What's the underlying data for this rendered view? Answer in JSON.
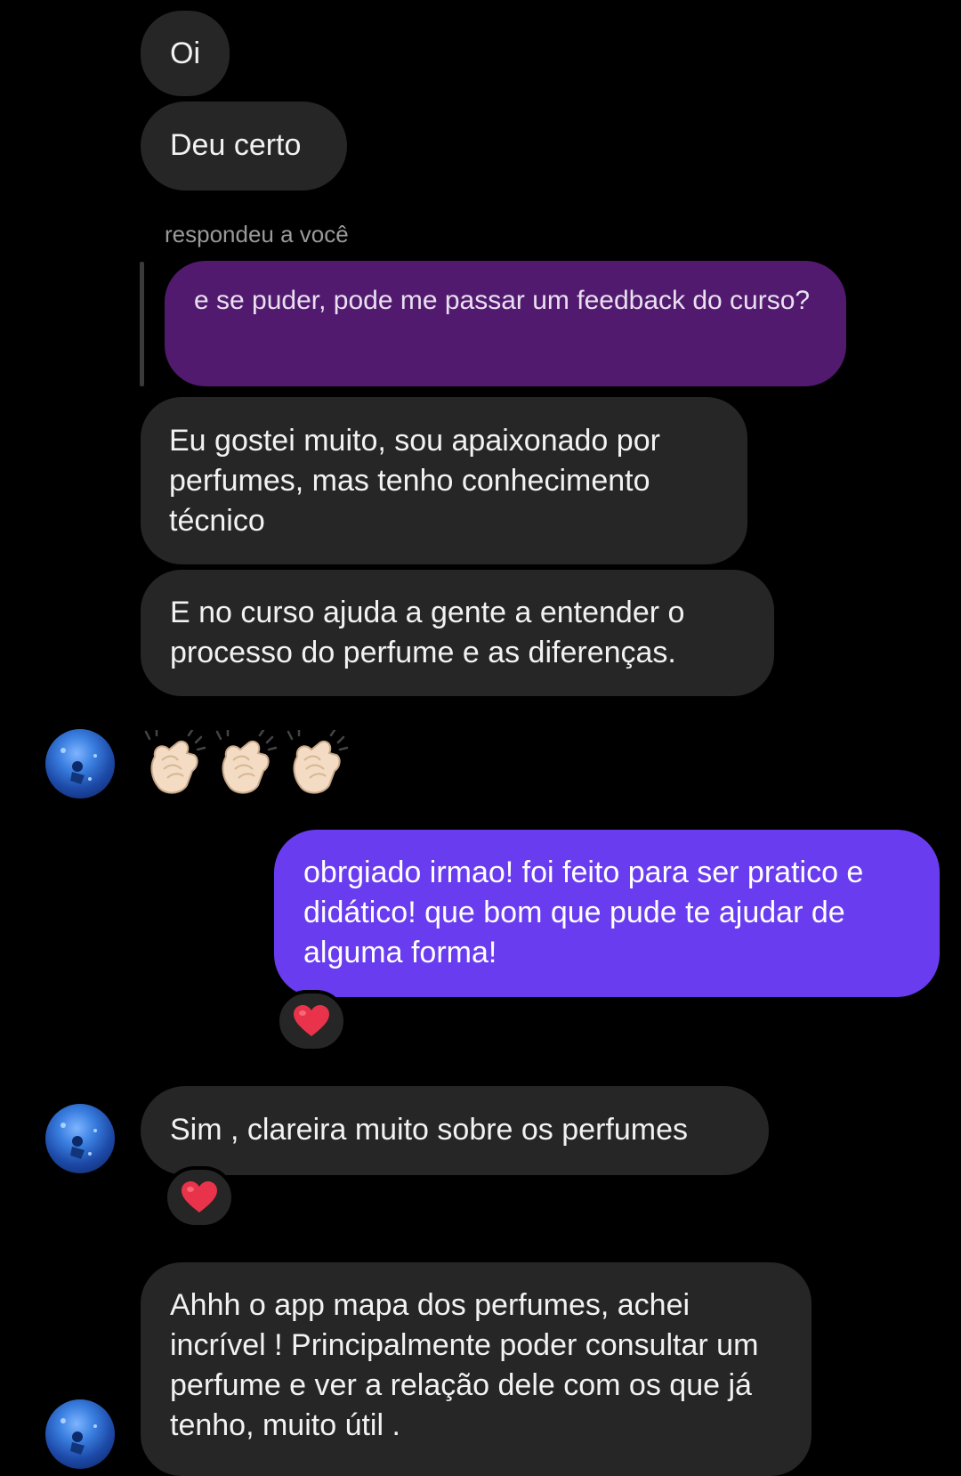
{
  "conversation": {
    "messages": [
      {
        "text": "Oi"
      },
      {
        "text": "Deu certo"
      },
      {
        "reply_label": "respondeu a você",
        "quoted_text": "e se puder, pode me passar um feedback do curso?"
      },
      {
        "text": "Eu gostei muito, sou apaixonado por perfumes, mas tenho conhecimento técnico"
      },
      {
        "text": "E no curso ajuda a gente a entender o processo do perfume e as diferenças."
      },
      {
        "emoji": "👏🏻👏🏻👏🏻",
        "emoji_icon": "clapping-hands-icon"
      },
      {
        "text": "obrgiado irmao! foi feito para ser pratico e didático! que bom que pude te ajudar de alguma forma!",
        "reaction": "❤️"
      },
      {
        "text": "Sim , clareira muito sobre os perfumes",
        "reaction": "❤️"
      },
      {
        "text": "Ahhh o app mapa dos perfumes, achei incrível ! Principalmente poder consultar um perfume e ver a relação dele com os que já tenho, muito útil ."
      }
    ]
  },
  "colors": {
    "background": "#000000",
    "incoming_bubble": "#262626",
    "outgoing_bubble": "#6a3cf0",
    "quoted_bubble": "#521a6e",
    "reaction_heart": "#e8334a"
  },
  "icons": {
    "avatar": "profile-avatar-icon",
    "heart": "heart-icon",
    "clap": "clapping-hands-icon"
  }
}
